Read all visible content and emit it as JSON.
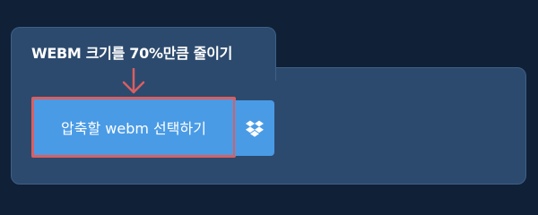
{
  "panel": {
    "title": "WEBM 크기를 70%만큼 줄이기"
  },
  "buttons": {
    "select_label": "압축할 webm 선택하기",
    "dropbox_icon": "dropbox-icon"
  },
  "colors": {
    "background": "#102037",
    "panel": "#2c4a6e",
    "button": "#4a9be6",
    "highlight": "#d95f62"
  }
}
